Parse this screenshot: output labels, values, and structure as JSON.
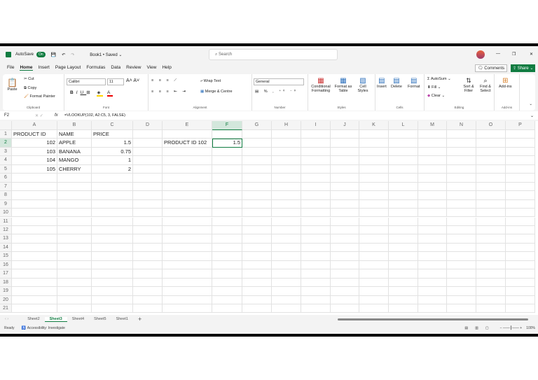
{
  "titlebar": {
    "autosave": "AutoSave",
    "toggle": "On",
    "doc": "Book1 • Saved ⌄",
    "search": "Search",
    "minimize": "—",
    "restore": "❐",
    "close": "✕"
  },
  "menu": [
    "File",
    "Home",
    "Insert",
    "Page Layout",
    "Formulas",
    "Data",
    "Review",
    "View",
    "Help"
  ],
  "actions": {
    "comments": "Comments",
    "share": "Share"
  },
  "ribbon": {
    "clipboard": {
      "paste": "Paste",
      "cut": "Cut",
      "copy": "Copy",
      "painter": "Format Painter",
      "label": "Clipboard"
    },
    "font": {
      "name": "Calibri",
      "size": "11",
      "label": "Font"
    },
    "alignment": {
      "wrap": "Wrap Text",
      "merge": "Merge & Centre",
      "label": "Alignment"
    },
    "number": {
      "format": "General",
      "label": "Number"
    },
    "styles": {
      "cond": "Conditional Formatting",
      "table": "Format as Table",
      "cell": "Cell Styles",
      "label": "Styles"
    },
    "cells": {
      "insert": "Insert",
      "delete": "Delete",
      "format": "Format",
      "label": "Cells"
    },
    "editing": {
      "autosum": "AutoSum",
      "fill": "Fill",
      "clear": "Clear",
      "sort": "Sort & Filter",
      "find": "Find & Select",
      "label": "Editing"
    },
    "addins": {
      "addins": "Add-ins",
      "label": "Add-ins"
    }
  },
  "formula_bar": {
    "name_box": "F2",
    "fx": "fx",
    "formula": "=VLOOKUP(102, A2:C5, 3, FALSE)"
  },
  "grid": {
    "columns": [
      "A",
      "B",
      "C",
      "D",
      "E",
      "F",
      "G",
      "H",
      "I",
      "J",
      "K",
      "L",
      "M",
      "N",
      "O",
      "P"
    ],
    "row_count": 21,
    "selected": "F2",
    "cells": [
      {
        "ref": "A1",
        "v": "PRODUCT ID"
      },
      {
        "ref": "B1",
        "v": "NAME"
      },
      {
        "ref": "C1",
        "v": "PRICE"
      },
      {
        "ref": "A2",
        "v": "102",
        "num": true
      },
      {
        "ref": "B2",
        "v": "APPLE"
      },
      {
        "ref": "C2",
        "v": "1.5",
        "num": true
      },
      {
        "ref": "A3",
        "v": "103",
        "num": true
      },
      {
        "ref": "B3",
        "v": "BANANA"
      },
      {
        "ref": "C3",
        "v": "0.75",
        "num": true
      },
      {
        "ref": "A4",
        "v": "104",
        "num": true
      },
      {
        "ref": "B4",
        "v": "MANGO"
      },
      {
        "ref": "C4",
        "v": "1",
        "num": true
      },
      {
        "ref": "A5",
        "v": "105",
        "num": true
      },
      {
        "ref": "B5",
        "v": "CHERRY"
      },
      {
        "ref": "C5",
        "v": "2",
        "num": true
      },
      {
        "ref": "E2",
        "v": "PRODUCT ID 102"
      },
      {
        "ref": "F2",
        "v": "1.5",
        "num": true
      }
    ]
  },
  "sheets": {
    "tabs": [
      "Sheet2",
      "Sheet3",
      "Sheet4",
      "Sheet5",
      "Sheet1"
    ],
    "active": "Sheet3",
    "add": "+"
  },
  "status": {
    "ready": "Ready",
    "accessibility": "Accessibility: Investigate",
    "zoom": "100%"
  }
}
